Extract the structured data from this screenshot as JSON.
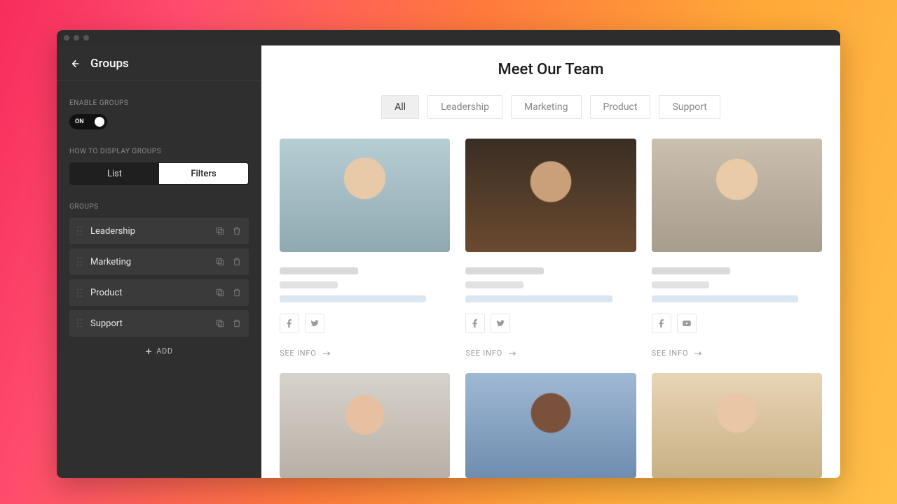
{
  "sidebar": {
    "title": "Groups",
    "enable_label": "ENABLE GROUPS",
    "toggle_state": "ON",
    "display_label": "HOW TO DISPLAY GROUPS",
    "segmented": {
      "list": "List",
      "filters": "Filters",
      "active": "filters"
    },
    "groups_label": "GROUPS",
    "items": [
      {
        "label": "Leadership"
      },
      {
        "label": "Marketing"
      },
      {
        "label": "Product"
      },
      {
        "label": "Support"
      }
    ],
    "add_label": "ADD"
  },
  "page": {
    "title": "Meet Our Team",
    "filters": [
      {
        "label": "All",
        "active": true
      },
      {
        "label": "Leadership",
        "active": false
      },
      {
        "label": "Marketing",
        "active": false
      },
      {
        "label": "Product",
        "active": false
      },
      {
        "label": "Support",
        "active": false
      }
    ],
    "see_info_label": "SEE INFO",
    "cards": [
      {
        "socials": [
          "facebook",
          "twitter"
        ]
      },
      {
        "socials": [
          "facebook",
          "twitter"
        ]
      },
      {
        "socials": [
          "facebook",
          "youtube"
        ]
      },
      {
        "socials": []
      },
      {
        "socials": []
      },
      {
        "socials": []
      }
    ]
  }
}
